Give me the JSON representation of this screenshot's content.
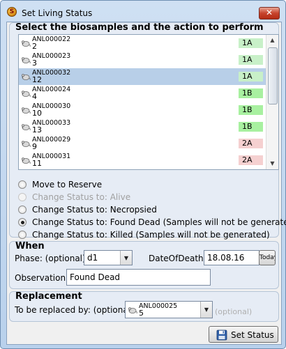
{
  "window": {
    "title": "Set Living Status",
    "app_icon": "S",
    "close_icon": "✕"
  },
  "biosamples": {
    "title": "Select the biosamples and the action to perform",
    "items": [
      {
        "id": "ANL000022",
        "number": "2",
        "group": "1A",
        "group_color": "#c8f0c8",
        "selected": false
      },
      {
        "id": "ANL000023",
        "number": "3",
        "group": "1A",
        "group_color": "#c8f0c8",
        "selected": false
      },
      {
        "id": "ANL000032",
        "number": "12",
        "group": "1A",
        "group_color": "#c8f0c8",
        "selected": true
      },
      {
        "id": "ANL000024",
        "number": "4",
        "group": "1B",
        "group_color": "#a8f0a0",
        "selected": false
      },
      {
        "id": "ANL000030",
        "number": "10",
        "group": "1B",
        "group_color": "#a8f0a0",
        "selected": false
      },
      {
        "id": "ANL000033",
        "number": "13",
        "group": "1B",
        "group_color": "#a8f0a0",
        "selected": false
      },
      {
        "id": "ANL000029",
        "number": "9",
        "group": "2A",
        "group_color": "#f5d0d0",
        "selected": false
      },
      {
        "id": "ANL000031",
        "number": "11",
        "group": "2A",
        "group_color": "#f5d0d0",
        "selected": false
      }
    ]
  },
  "actions": [
    {
      "label": "Move to Reserve",
      "checked": false,
      "disabled": false
    },
    {
      "label": "Change Status to: Alive",
      "checked": false,
      "disabled": true
    },
    {
      "label": "Change Status to: Necropsied",
      "checked": false,
      "disabled": false
    },
    {
      "label": "Change Status to: Found Dead (Samples will not be generated)",
      "checked": true,
      "disabled": false
    },
    {
      "label": "Change Status to: Killed (Samples will not be generated)",
      "checked": false,
      "disabled": false
    }
  ],
  "when": {
    "title": "When",
    "phase_label": "Phase: (optional)",
    "phase_value": "d1",
    "date_label": "DateOfDeath:",
    "date_value": "18.08.16",
    "today_label": "Today",
    "observation_label": "Observation:",
    "observation_value": "Found Dead"
  },
  "replacement": {
    "title": "Replacement",
    "label": "To be replaced by: (optional)",
    "selected_id": "ANL000025",
    "selected_number": "5",
    "faded_hint": "(optional)"
  },
  "footer": {
    "set_status_label": "Set Status"
  }
}
